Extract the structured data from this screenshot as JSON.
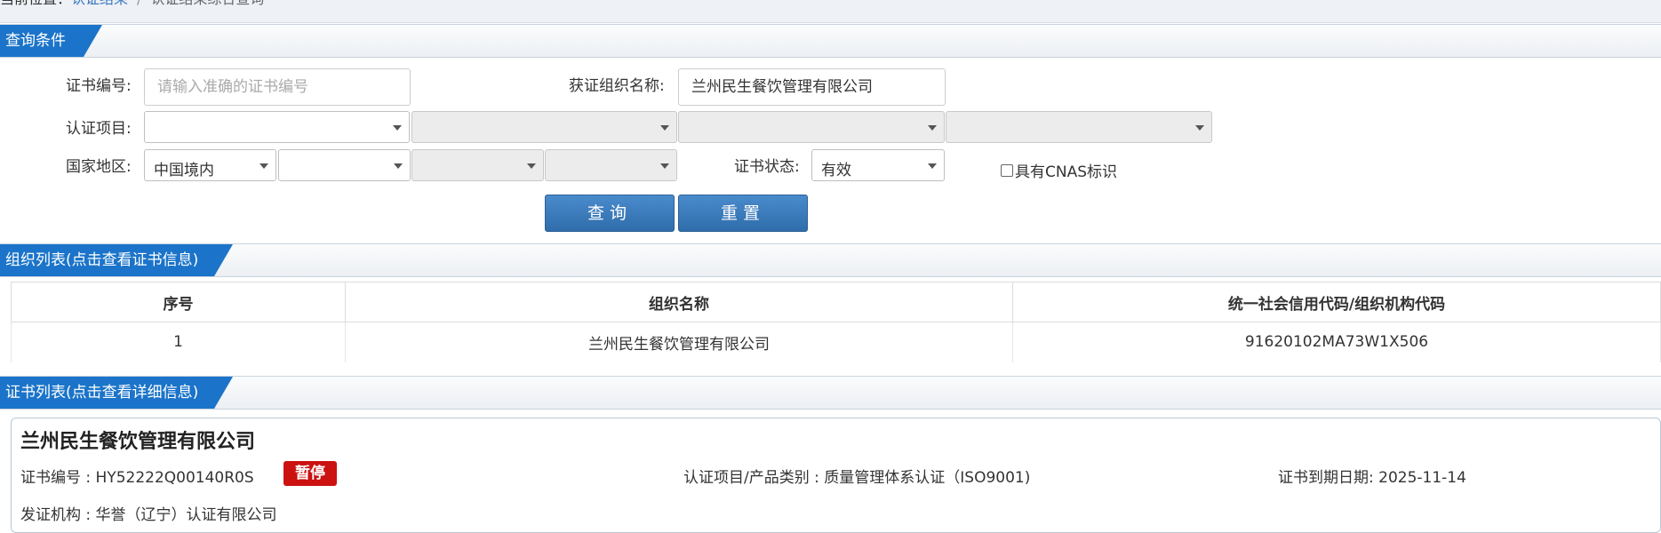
{
  "breadcrumb": {
    "prefix": "当前位置：",
    "link": "认证结果",
    "separator": "/",
    "current": "认证结果综合查询"
  },
  "query_section": {
    "title": "查询条件",
    "cert_no_label": "证书编号:",
    "cert_no_placeholder": "请输入准确的证书编号",
    "cert_no_value": "",
    "org_name_label": "获证组织名称:",
    "org_name_value": "兰州民生餐饮管理有限公司",
    "project_label": "认证项目:",
    "project_selects": [
      "",
      "",
      "",
      ""
    ],
    "region_label": "国家地区:",
    "region_selects": [
      "中国境内",
      "",
      "",
      ""
    ],
    "status_label": "证书状态:",
    "status_value": "有效",
    "cnas_label": "具有CNAS标识",
    "search_button": "查询",
    "reset_button": "重置"
  },
  "org_section": {
    "title": "组织列表(点击查看证书信息)",
    "columns": [
      "序号",
      "组织名称",
      "统一社会信用代码/组织机构代码"
    ],
    "rows": [
      [
        "1",
        "兰州民生餐饮管理有限公司",
        "91620102MA73W1X506"
      ]
    ]
  },
  "cert_section": {
    "title": "证书列表(点击查看详细信息)",
    "cert": {
      "org_name": "兰州民生餐饮管理有限公司",
      "cert_no": "证书编号 : HY52222Q00140R0S",
      "status_badge": "暂停",
      "project": "认证项目/产品类别 : 质量管理体系认证（ISO9001)",
      "expiry": "证书到期日期: 2025-11-14",
      "issuer": "发证机构 : 华誉（辽宁）认证有限公司"
    }
  },
  "colors": {
    "section_tab": "#1b74c9",
    "button": "#3575b5",
    "badge": "#cc1111"
  }
}
